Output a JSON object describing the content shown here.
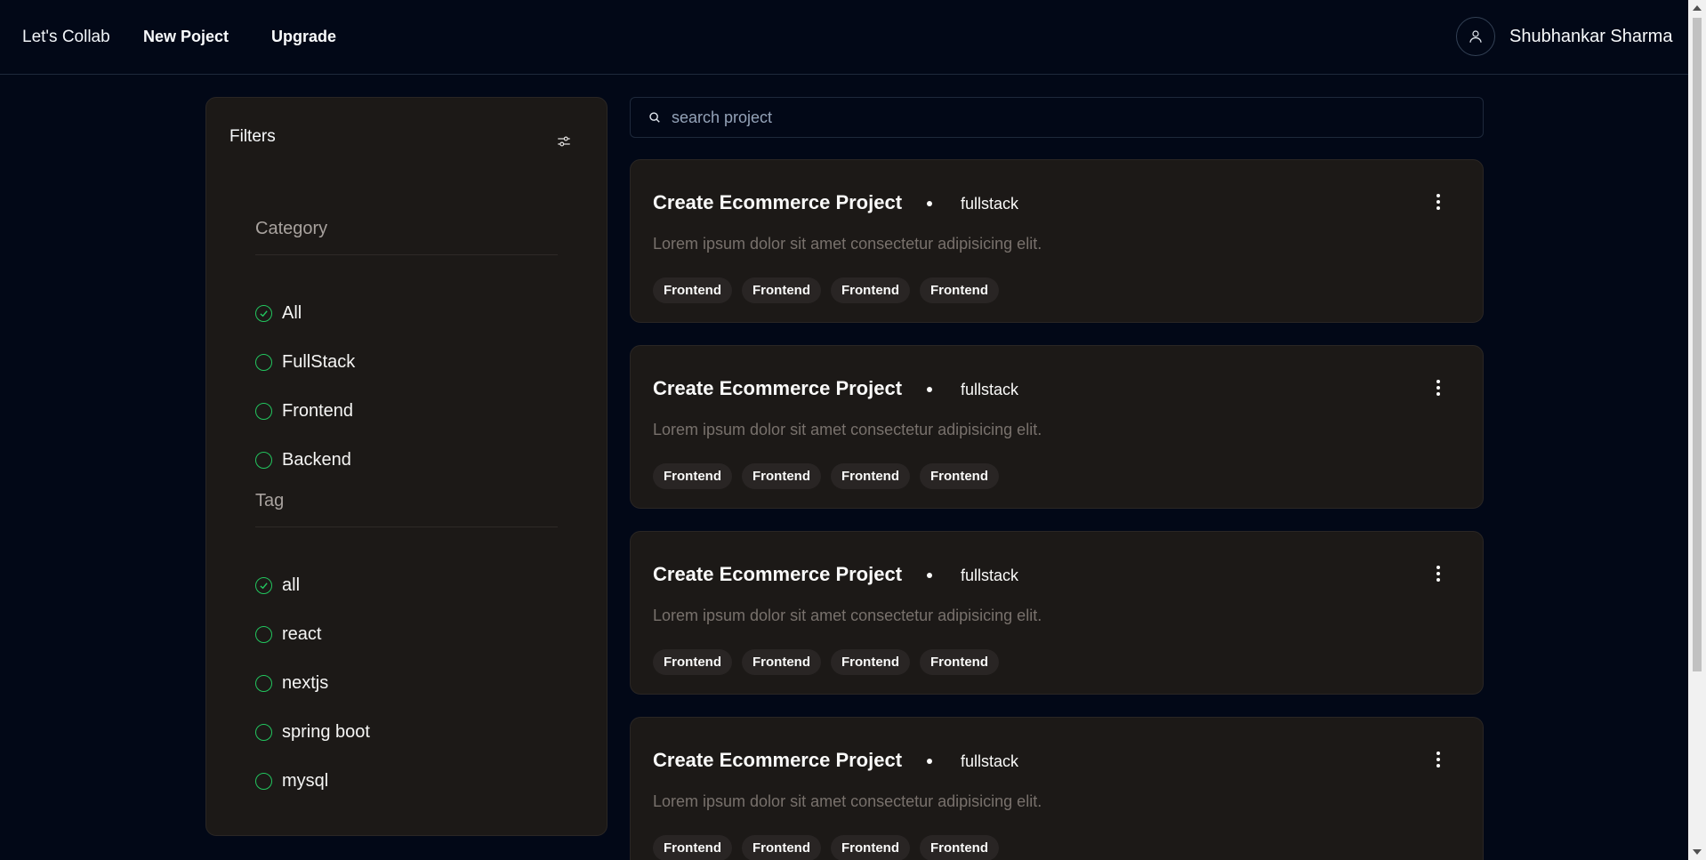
{
  "nav": {
    "brand": "Let's Collab",
    "new_project": "New Poject",
    "upgrade": "Upgrade",
    "user_name": "Shubhankar Sharma",
    "avatar_icon": "user-icon"
  },
  "filters": {
    "title": "Filters",
    "icon": "sliders-icon",
    "category": {
      "title": "Category",
      "options": [
        {
          "label": "All",
          "checked": true
        },
        {
          "label": "FullStack",
          "checked": false
        },
        {
          "label": "Frontend",
          "checked": false
        },
        {
          "label": "Backend",
          "checked": false
        }
      ]
    },
    "tag": {
      "title": "Tag",
      "options": [
        {
          "label": "all",
          "checked": true
        },
        {
          "label": "react",
          "checked": false
        },
        {
          "label": "nextjs",
          "checked": false
        },
        {
          "label": "spring boot",
          "checked": false
        },
        {
          "label": "mysql",
          "checked": false
        }
      ]
    },
    "accent_color": "#22c55e"
  },
  "search": {
    "placeholder": "search project",
    "icon": "search-icon"
  },
  "projects": [
    {
      "title": "Create Ecommerce Project",
      "category": "fullstack",
      "description": "Lorem ipsum dolor sit amet consectetur adipisicing elit.",
      "tags": [
        "Frontend",
        "Frontend",
        "Frontend",
        "Frontend"
      ]
    },
    {
      "title": "Create Ecommerce Project",
      "category": "fullstack",
      "description": "Lorem ipsum dolor sit amet consectetur adipisicing elit.",
      "tags": [
        "Frontend",
        "Frontend",
        "Frontend",
        "Frontend"
      ]
    },
    {
      "title": "Create Ecommerce Project",
      "category": "fullstack",
      "description": "Lorem ipsum dolor sit amet consectetur adipisicing elit.",
      "tags": [
        "Frontend",
        "Frontend",
        "Frontend",
        "Frontend"
      ]
    },
    {
      "title": "Create Ecommerce Project",
      "category": "fullstack",
      "description": "Lorem ipsum dolor sit amet consectetur adipisicing elit.",
      "tags": [
        "Frontend",
        "Frontend",
        "Frontend",
        "Frontend"
      ]
    }
  ]
}
